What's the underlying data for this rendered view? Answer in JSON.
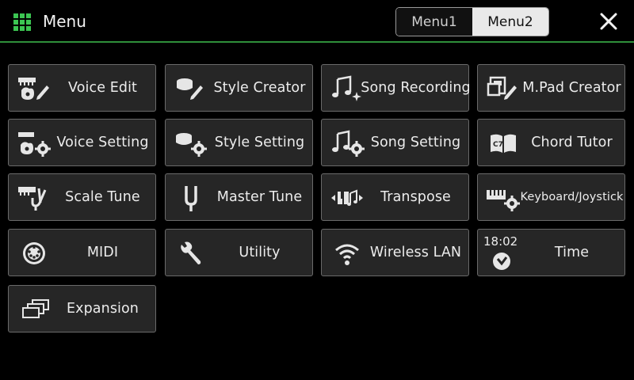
{
  "header": {
    "title": "Menu",
    "tabs": [
      {
        "label": "Menu1",
        "active": false
      },
      {
        "label": "Menu2",
        "active": true
      }
    ]
  },
  "colors": {
    "accent_green": "#3cc552",
    "header_rule": "#2f8f3a",
    "button_bg": "#262626",
    "button_border": "#6a6a6a"
  },
  "menu": {
    "items": [
      {
        "label": "Voice Edit",
        "icon": "voice-edit-icon"
      },
      {
        "label": "Style Creator",
        "icon": "style-creator-icon"
      },
      {
        "label": "Song Recording",
        "icon": "song-recording-icon"
      },
      {
        "label": "M.Pad Creator",
        "icon": "mpad-creator-icon"
      },
      {
        "label": "Voice Setting",
        "icon": "voice-setting-icon"
      },
      {
        "label": "Style Setting",
        "icon": "style-setting-icon"
      },
      {
        "label": "Song Setting",
        "icon": "song-setting-icon"
      },
      {
        "label": "Chord Tutor",
        "icon": "chord-tutor-icon"
      },
      {
        "label": "Scale Tune",
        "icon": "scale-tune-icon"
      },
      {
        "label": "Master Tune",
        "icon": "tuning-fork-icon"
      },
      {
        "label": "Transpose",
        "icon": "transpose-icon"
      },
      {
        "label": "Keyboard/Joystick",
        "icon": "keyboard-gear-icon"
      },
      {
        "label": "MIDI",
        "icon": "midi-icon"
      },
      {
        "label": "Utility",
        "icon": "wrench-icon"
      },
      {
        "label": "Wireless LAN",
        "icon": "wifi-icon"
      },
      {
        "label": "Time",
        "icon": "clock-icon",
        "time": "18:02"
      },
      {
        "label": "Expansion",
        "icon": "expansion-icon"
      }
    ]
  }
}
